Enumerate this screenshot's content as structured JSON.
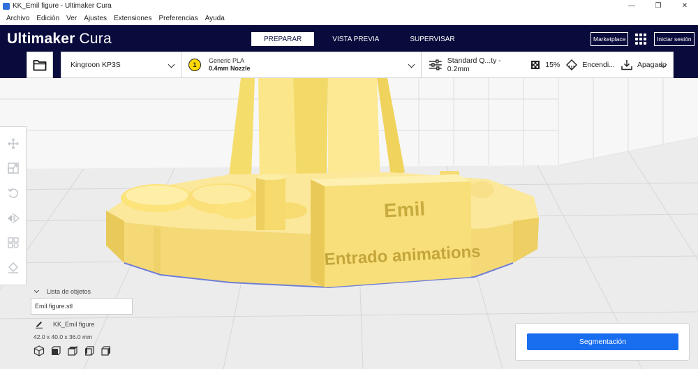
{
  "window": {
    "title": "KK_Emil figure - Ultimaker Cura",
    "controls": [
      "—",
      "❐",
      "✕"
    ]
  },
  "menu": [
    "Archivo",
    "Edición",
    "Ver",
    "Ajustes",
    "Extensiones",
    "Preferencias",
    "Ayuda"
  ],
  "header": {
    "logo_bold": "Ultimaker",
    "logo_light": " Cura",
    "stages": [
      "PREPARAR",
      "VISTA PREVIA",
      "SUPERVISAR"
    ],
    "active_stage": "PREPARAR",
    "marketplace": "Marketplace",
    "signin": "Iniciar sesión"
  },
  "machine": {
    "printer": "Kingroon KP3S",
    "extruder_number": "1",
    "material": "Generic PLA",
    "nozzle": "0.4mm Nozzle",
    "profile": "Standard Q...ty - 0.2mm",
    "infill": "15%",
    "support": "Encendi...",
    "adhesion": "Apagado"
  },
  "model": {
    "plate_text_line1": "Emil",
    "plate_text_line2": "Entrado animations"
  },
  "objects": {
    "header": "Lista de objetos",
    "file": "Emil figure.stl",
    "name": "KK_Emil figure",
    "dimensions": "42.0 x 40.0 x 36.0 mm"
  },
  "slice": {
    "button": "Segmentación"
  },
  "colors": {
    "header_bg": "#0a0b3d",
    "accent": "#196ef0",
    "model": "#fbe68a"
  }
}
